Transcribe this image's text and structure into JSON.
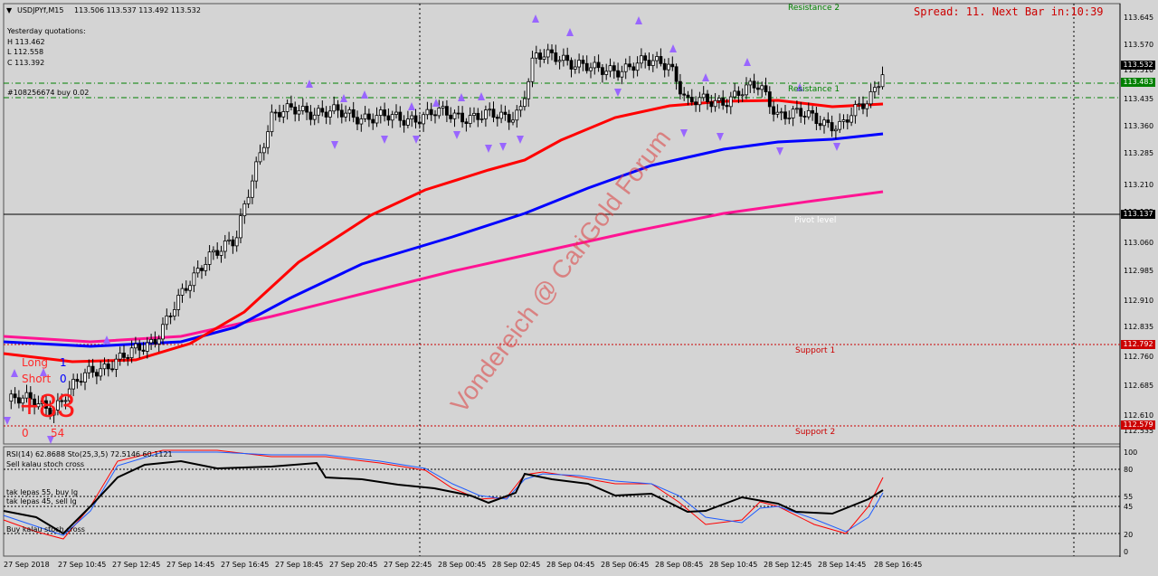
{
  "header": {
    "collapse_glyph": "▼",
    "symbol": "USDJPYf,M15",
    "ohlc": "113.506 113.537 113.492 113.532"
  },
  "yesterday": {
    "title": "Yesterday quotations:",
    "high": "H 113.462",
    "low": "L 112.558",
    "close": "C 113.392"
  },
  "order_label": "#108256674 buy 0.02",
  "spread_label": "Spread: 11. Next Bar in:10:39",
  "levels": {
    "resistance2": "Resistance 2",
    "resistance1": "Resistance 1",
    "pivot": "Pivot level",
    "support1": "Support 1",
    "support2": "Support 2"
  },
  "long_short": {
    "long_label": "Long",
    "long_value": "1",
    "short_label": "Short",
    "short_value": "0",
    "big_number": "+83",
    "bottom_left": "0",
    "bottom_right": "54"
  },
  "watermark": "Vondereich @ CariGold Forum",
  "price_axis": [
    "113.645",
    "113.570",
    "113.510",
    "113.435",
    "113.360",
    "113.285",
    "113.210",
    "113.135",
    "113.060",
    "112.985",
    "112.910",
    "112.835",
    "112.760",
    "112.685",
    "112.610",
    "112.535"
  ],
  "price_tags": {
    "current": "113.532",
    "resistance1": "113.483",
    "pivot": "113.137",
    "support1": "112.792",
    "support2": "112.579"
  },
  "sub_window": {
    "title": "RSI(14) 62.8688  Sto(25,3,5) 72.5146 60.1121",
    "sell_note": "Sell kalau stoch cross",
    "buy_note_55": "tak lepas 55, buy lg",
    "sell_note_45": "tak lepas 45, sell lg",
    "buy_note": "Buy kalau stoch cross",
    "axis": [
      "100",
      "80",
      "55",
      "45",
      "20",
      "0"
    ]
  },
  "time_axis": [
    "27 Sep 2018",
    "27 Sep 10:45",
    "27 Sep 12:45",
    "27 Sep 14:45",
    "27 Sep 16:45",
    "27 Sep 18:45",
    "27 Sep 20:45",
    "27 Sep 22:45",
    "28 Sep 00:45",
    "28 Sep 02:45",
    "28 Sep 04:45",
    "28 Sep 06:45",
    "28 Sep 08:45",
    "28 Sep 10:45",
    "28 Sep 12:45",
    "28 Sep 14:45",
    "28 Sep 16:45"
  ],
  "colors": {
    "background": "#d4d4d4",
    "ma_fast": "#ff0000",
    "ma_mid": "#0000ff",
    "ma_slow": "#ff1493",
    "resistance": "#008000",
    "support": "#cc0000",
    "spread": "#cc0000",
    "arrow": "#9966ff"
  }
}
